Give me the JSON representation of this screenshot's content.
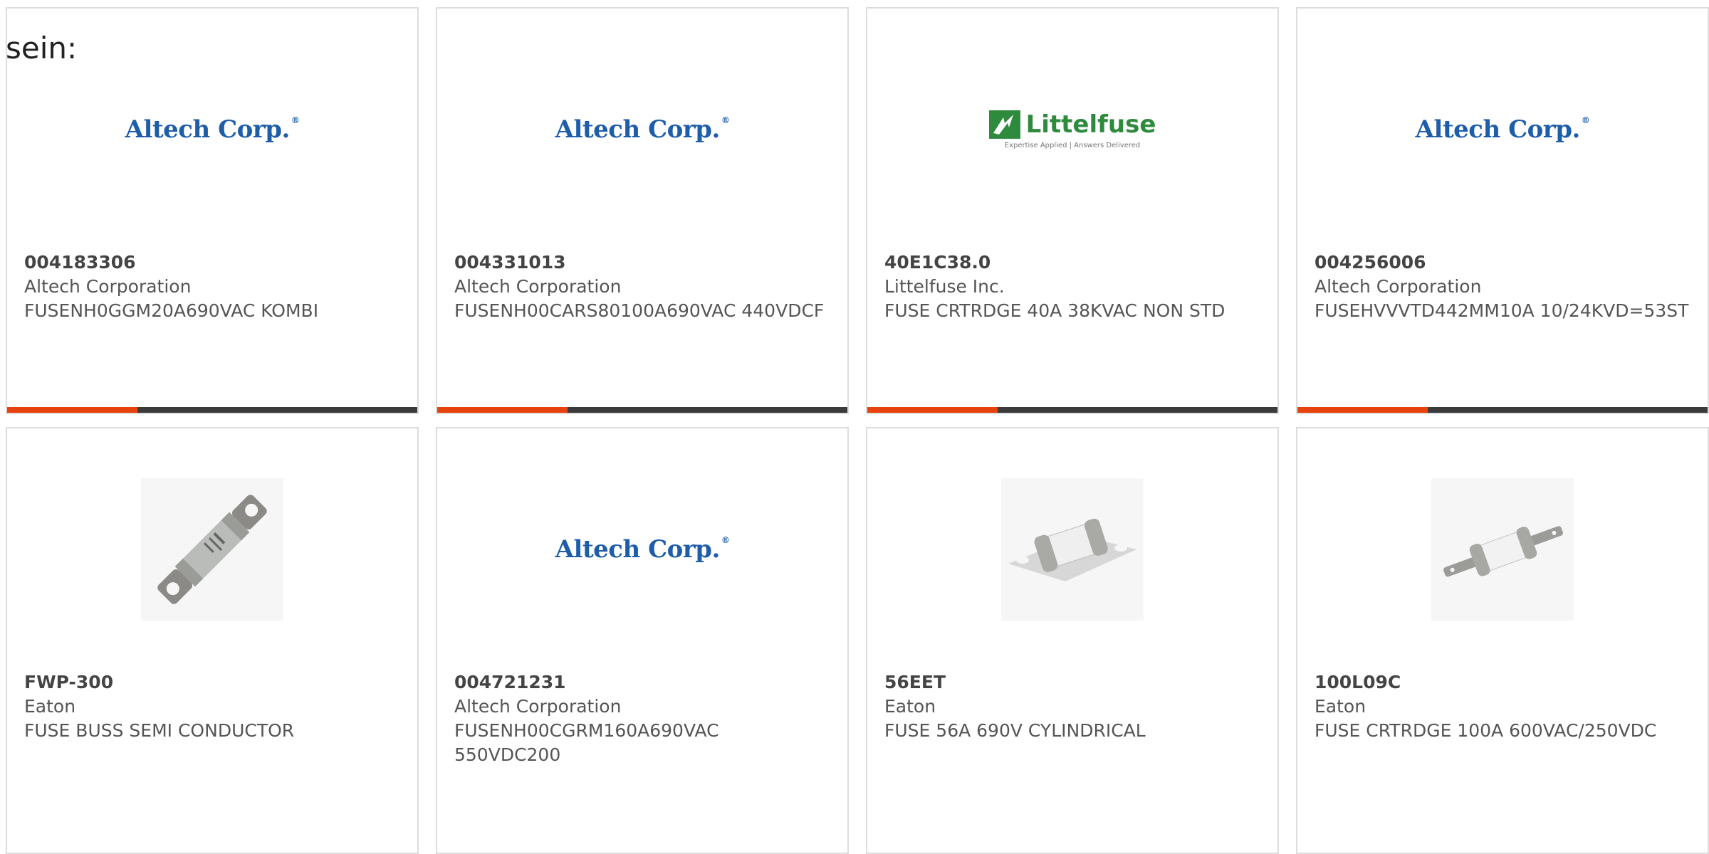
{
  "intro_text": "sein:",
  "logos": {
    "altech": "Altech Corp.",
    "littelfuse_name": "Littelfuse",
    "littelfuse_tagline": "Expertise Applied | Answers Delivered"
  },
  "colors": {
    "accent": "#e8430f",
    "bar": "#3b3b3b",
    "altech_blue": "#1d5da9",
    "littelfuse_green": "#2e8b3d"
  },
  "cards": [
    {
      "image": "altech-logo",
      "part_number": "004183306",
      "manufacturer": "Altech Corporation",
      "description": "FUSENH0GGM20A690VAC KOMBI"
    },
    {
      "image": "altech-logo",
      "part_number": "004331013",
      "manufacturer": "Altech Corporation",
      "description": "FUSENH00CARS80100A690VAC 440VDCF"
    },
    {
      "image": "littelfuse-logo",
      "part_number": "40E1C38.0",
      "manufacturer": "Littelfuse Inc.",
      "description": "FUSE CRTRDGE 40A 38KVAC NON STD"
    },
    {
      "image": "altech-logo",
      "part_number": "004256006",
      "manufacturer": "Altech Corporation",
      "description": "FUSEHVVVTD442MM10A 10/24KVD=53ST"
    },
    {
      "image": "bolt-fuse-photo",
      "part_number": "FWP-300",
      "manufacturer": "Eaton",
      "description": "FUSE BUSS SEMI CONDUCTOR"
    },
    {
      "image": "altech-logo",
      "part_number": "004721231",
      "manufacturer": "Altech Corporation",
      "description": "FUSENH00CGRM160A690VAC 550VDC200"
    },
    {
      "image": "cylindrical-fuse-photo",
      "part_number": "56EET",
      "manufacturer": "Eaton",
      "description": "FUSE 56A 690V CYLINDRICAL"
    },
    {
      "image": "tag-fuse-photo",
      "part_number": "100L09C",
      "manufacturer": "Eaton",
      "description": "FUSE CRTRDGE 100A 600VAC/250VDC"
    }
  ]
}
